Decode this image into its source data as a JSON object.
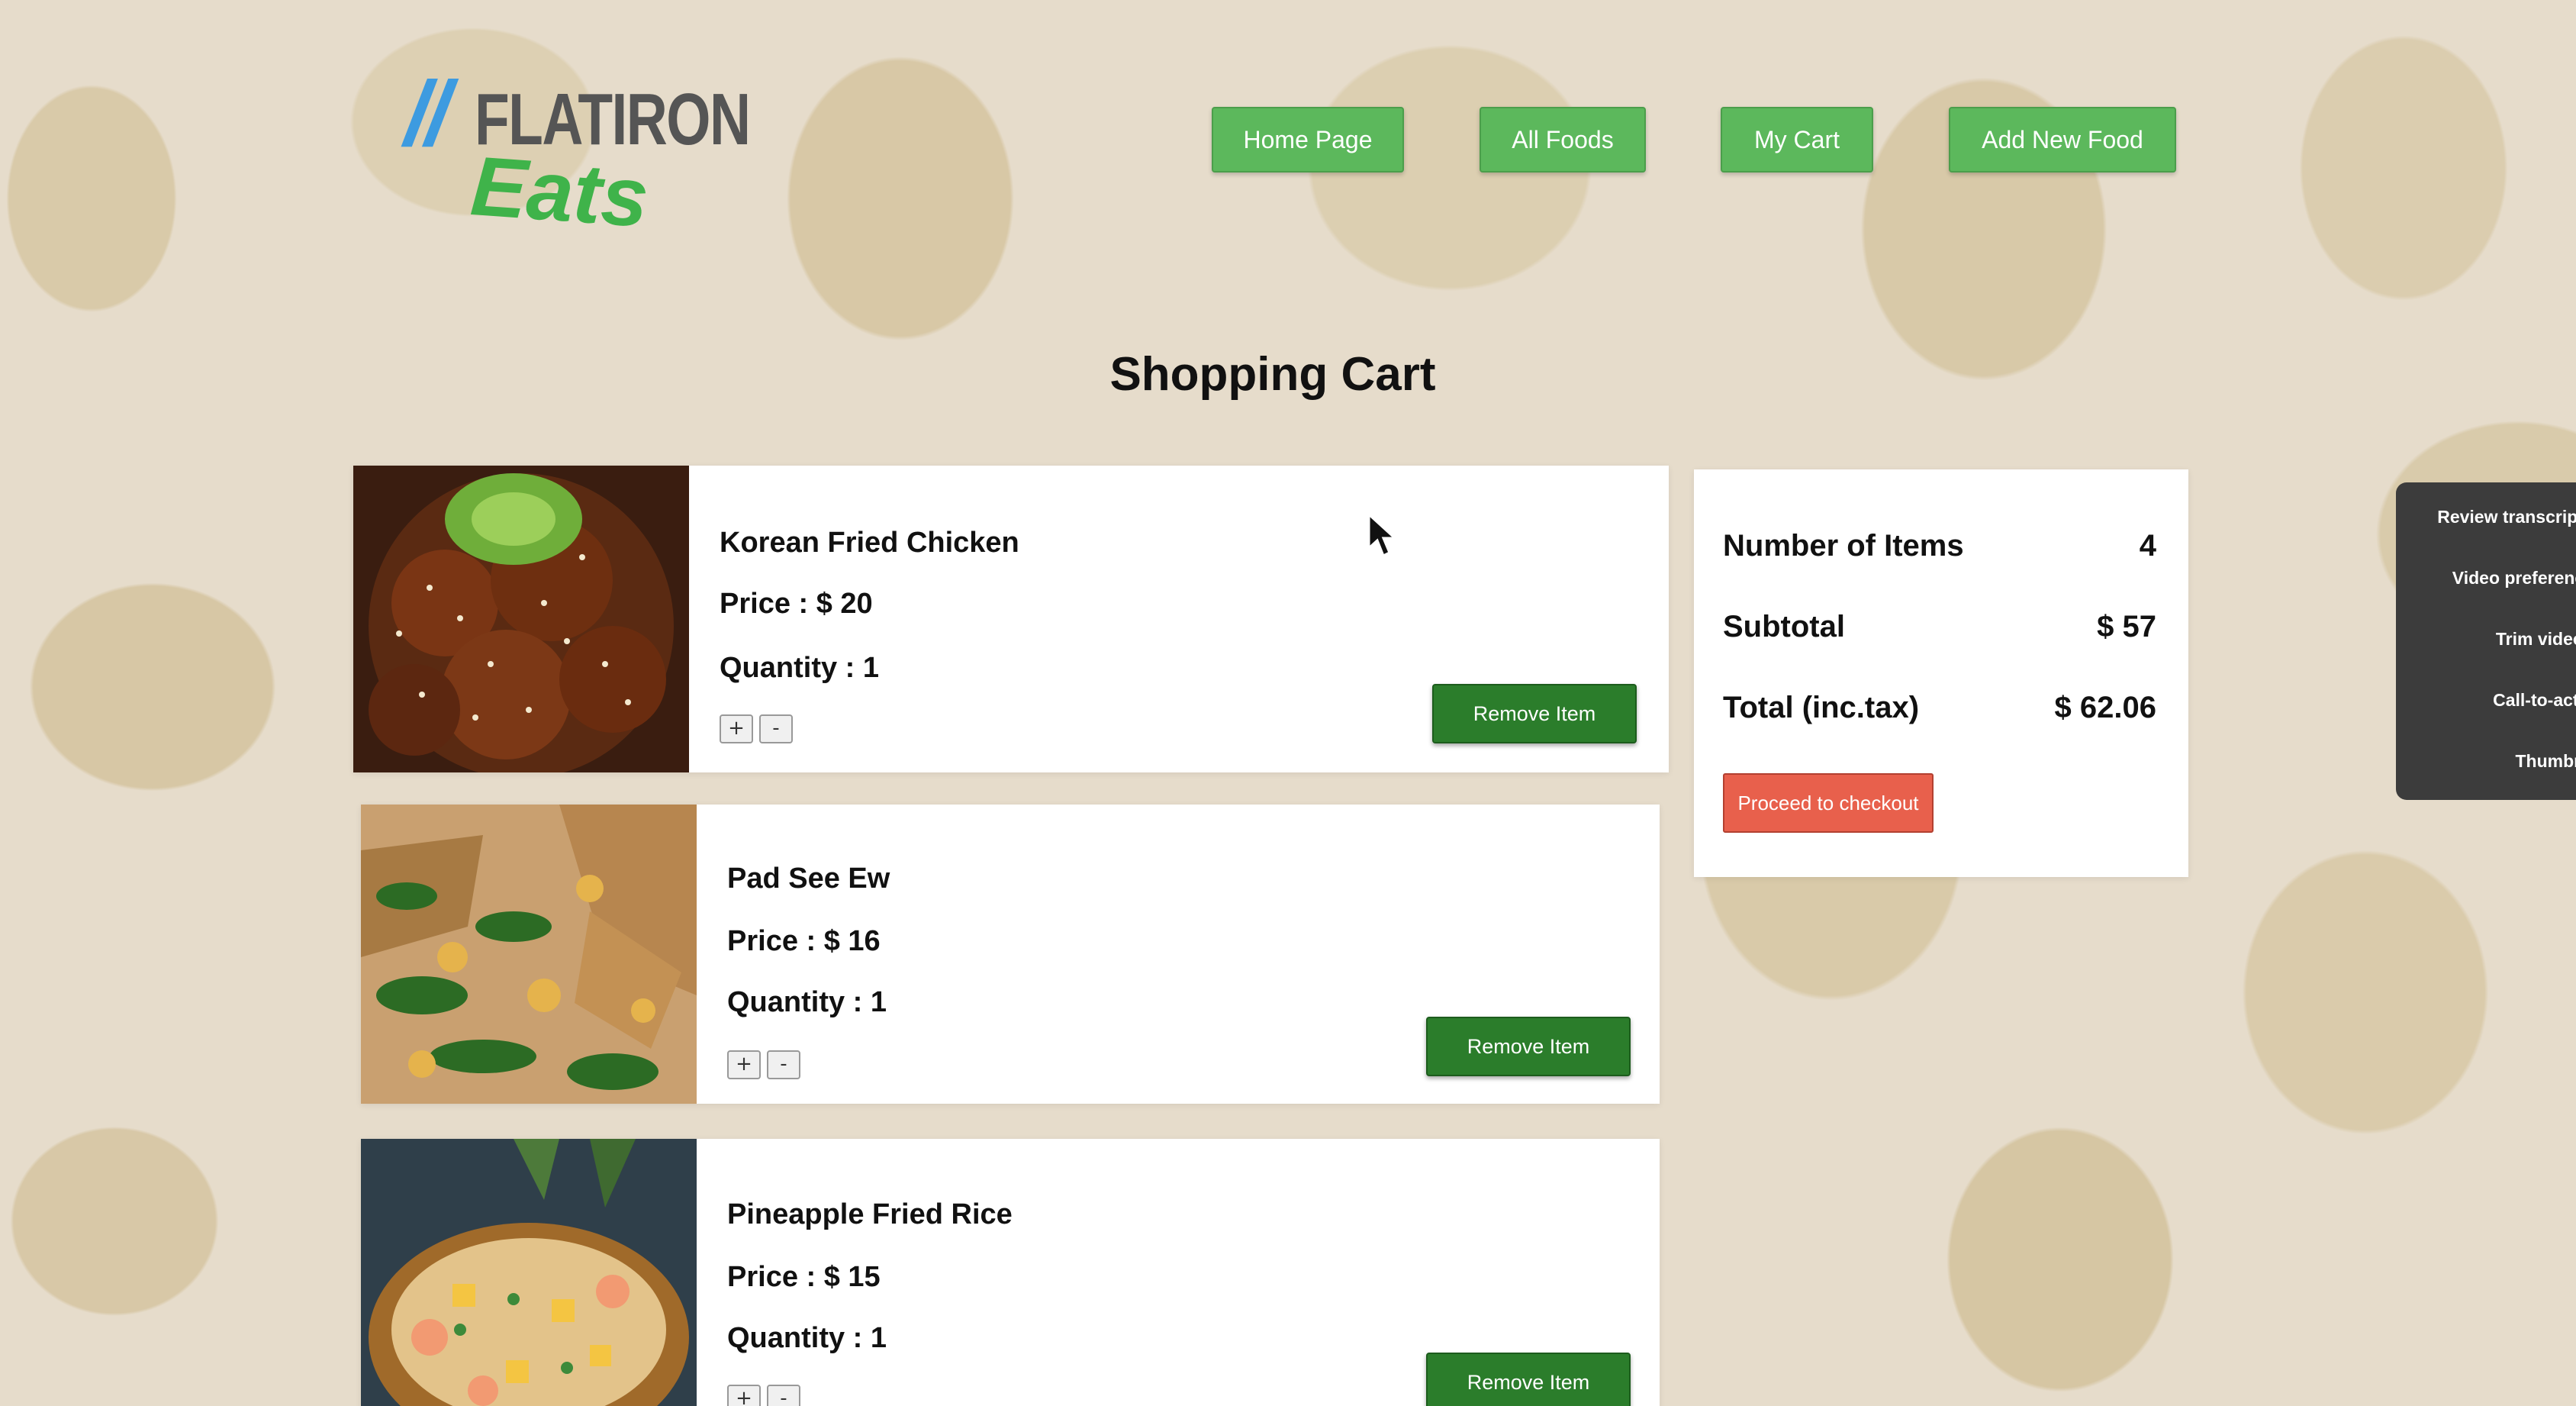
{
  "brand": {
    "logo_top": "FLATIRON",
    "logo_bottom": "Eats"
  },
  "nav": {
    "items": [
      {
        "label": "Home Page"
      },
      {
        "label": "All Foods"
      },
      {
        "label": "My Cart"
      },
      {
        "label": "Add New Food"
      }
    ]
  },
  "page": {
    "title": "Shopping Cart"
  },
  "cart": {
    "items": [
      {
        "name": "Korean Fried Chicken",
        "price": "Price : $ 20",
        "quantity": "Quantity : 1",
        "plus": "+",
        "minus": "-",
        "remove_label": "Remove Item"
      },
      {
        "name": "Pad See Ew",
        "price": "Price : $ 16",
        "quantity": "Quantity : 1",
        "plus": "+",
        "minus": "-",
        "remove_label": "Remove Item"
      },
      {
        "name": "Pineapple Fried Rice",
        "price": "Price : $ 15",
        "quantity": "Quantity : 1",
        "plus": "+",
        "minus": "-",
        "remove_label": "Remove Item"
      }
    ]
  },
  "summary": {
    "items_label": "Number of Items",
    "items_value": "4",
    "subtotal_label": "Subtotal",
    "subtotal_value": "$ 57",
    "total_label": "Total (inc.tax)",
    "total_value": "$ 62.06",
    "checkout_label": "Proceed to checkout"
  },
  "side_panel": {
    "items": [
      {
        "label": "Review transcript ("
      },
      {
        "label": "Video preference"
      },
      {
        "label": "Trim video ("
      },
      {
        "label": "Call-to-actio"
      },
      {
        "label": "Thumbna"
      }
    ]
  },
  "colors": {
    "nav_green": "#5cb85c",
    "remove_green": "#2b7d2b",
    "checkout_red": "#e8604c",
    "panel_dark": "#3c3c3c"
  }
}
